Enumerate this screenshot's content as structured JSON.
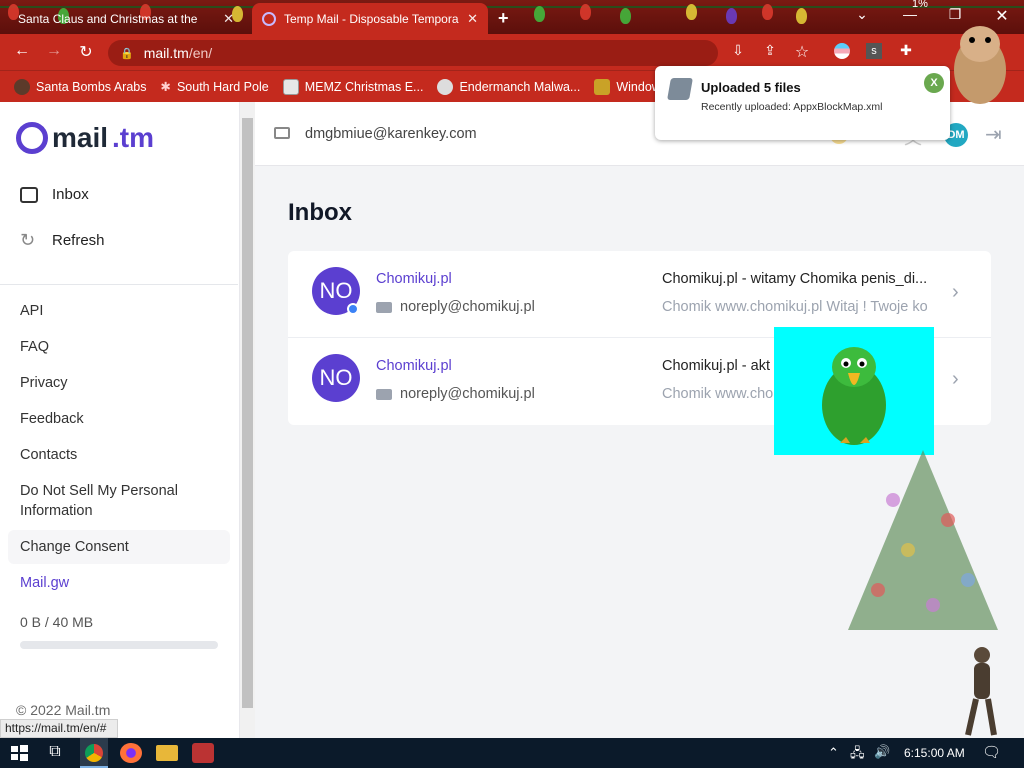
{
  "browser": {
    "tabs": [
      {
        "title": "Santa Claus and Christmas at the"
      },
      {
        "title": "Temp Mail - Disposable Tempora"
      }
    ],
    "url_host": "mail.tm",
    "url_path": "/en/",
    "bookmarks": [
      {
        "label": "Santa Bombs Arabs",
        "icon": "bomb-icon"
      },
      {
        "label": "South Hard Pole",
        "icon": "snowflake-icon"
      },
      {
        "label": "MEMZ Christmas E...",
        "icon": "memz-icon"
      },
      {
        "label": "Endermanch Malwa...",
        "icon": "raccoon-icon"
      },
      {
        "label": "Windows ISOs",
        "icon": "folder-icon"
      }
    ],
    "status_url": "https://mail.tm/en/#",
    "cpu_overlay": "1%"
  },
  "toast": {
    "title": "Uploaded 5 files",
    "subtitle": "Recently uploaded: AppxBlockMap.xml",
    "close_label": "X"
  },
  "app": {
    "logo_word": "mail",
    "logo_tld": ".tm",
    "address": "dmgbmiue@karenkey.com",
    "avatar_initials": "DM",
    "nav": [
      {
        "label": "Inbox",
        "icon": "inbox-icon"
      },
      {
        "label": "Refresh",
        "icon": "refresh-icon"
      }
    ],
    "links": [
      "API",
      "FAQ",
      "Privacy",
      "Feedback",
      "Contacts",
      "Do Not Sell My Personal Information",
      "Change Consent",
      "Mail.gw"
    ],
    "storage_used": "0 B",
    "storage_total": "/ 40 MB",
    "storage_fraction": 0,
    "copyright": "© 2022 Mail.tm",
    "inbox_title": "Inbox",
    "messages": [
      {
        "initials": "NO",
        "sender": "Chomikuj.pl",
        "from": "noreply@chomikuj.pl",
        "subject": "Chomikuj.pl - witamy Chomika penis_di...",
        "preview": "Chomik www.chomikuj.pl Witaj ! Twoje ko",
        "unread": true
      },
      {
        "initials": "NO",
        "sender": "Chomikuj.pl",
        "from": "noreply@chomikuj.pl",
        "subject": "Chomikuj.pl - akt",
        "preview": "Chomik www.cho",
        "unread": false
      }
    ]
  },
  "taskbar": {
    "time": "6:15:00 AM"
  }
}
